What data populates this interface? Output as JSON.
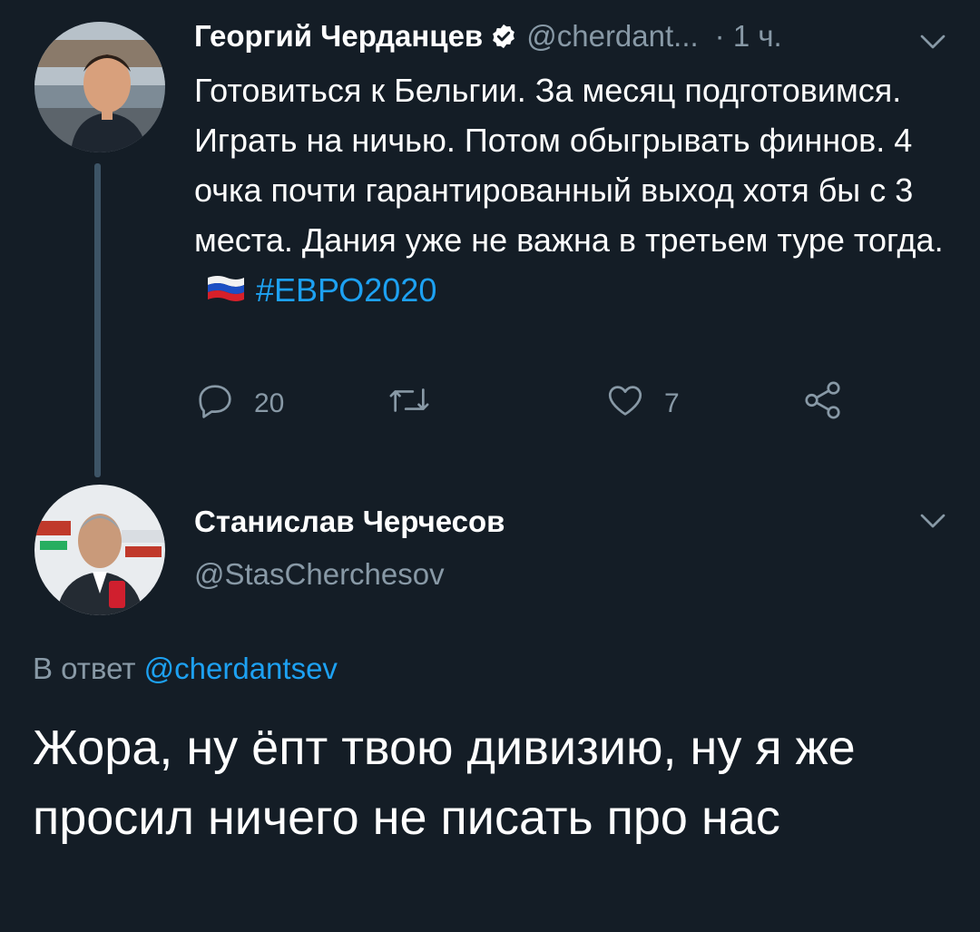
{
  "tweet1": {
    "display_name": "Георгий Черданцев",
    "handle": "@cherdant...",
    "time": "· 1 ч.",
    "text": "Готовиться к Бельгии. За месяц подготовимся. Играть на ничью. Потом обыгрывать финнов. 4 очка почти гарантированный выход хотя бы с 3 места. Дания уже не важна в третьем туре тогда.",
    "hashtag": "#ЕВРО2020",
    "reply_count": "20",
    "like_count": "7"
  },
  "tweet2": {
    "display_name": "Станислав Черчесов",
    "handle": "@StasCherchesov",
    "reply_prefix": "В ответ",
    "reply_mention": "@cherdantsev",
    "text": "Жора, ну ёпт твою дивизию, ну я же просил ничего не писать про нас"
  },
  "colors": {
    "background": "#141d26",
    "muted": "#8899a6",
    "accent": "#1da1f2",
    "thread_line": "#3d5466"
  },
  "icons": [
    "verified-icon",
    "chevron-down-icon",
    "reply-icon",
    "retweet-icon",
    "like-icon",
    "share-icon",
    "russia-flag-icon"
  ]
}
